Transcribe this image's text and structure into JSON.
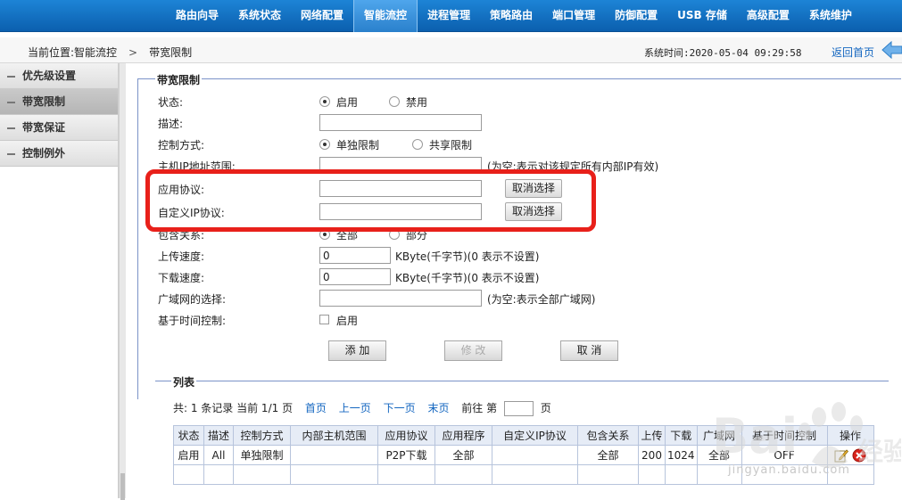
{
  "nav": {
    "items": [
      "路由向导",
      "系统状态",
      "网络配置",
      "智能流控",
      "进程管理",
      "策略路由",
      "端口管理",
      "防御配置",
      "USB 存储",
      "高级配置",
      "系统维护"
    ],
    "active": "智能流控"
  },
  "breadcrumb": {
    "location_label": "当前位置:智能流控",
    "separator": ">",
    "current": "带宽限制",
    "system_time": "系统时间:2020-05-04 09:29:58",
    "back_label": "返回首页"
  },
  "sidebar": {
    "items": [
      {
        "label": "优先级设置"
      },
      {
        "label": "带宽限制"
      },
      {
        "label": "带宽保证"
      },
      {
        "label": "控制例外"
      }
    ],
    "active": "带宽限制"
  },
  "form": {
    "legend": "带宽限制",
    "status": {
      "label": "状态:",
      "options": [
        "启用",
        "禁用"
      ],
      "selected": "启用"
    },
    "description": {
      "label": "描述:",
      "value": ""
    },
    "control_mode": {
      "label": "控制方式:",
      "options": [
        "单独限制",
        "共享限制"
      ],
      "selected": "单独限制"
    },
    "host_ip_range": {
      "label": "主机IP地址范围:",
      "value": "",
      "hint": "(为空:表示对该规定所有内部IP有效)"
    },
    "app_protocol": {
      "label": "应用协议:",
      "value": "",
      "button": "取消选择"
    },
    "custom_ip_protocol": {
      "label": "自定义IP协议:",
      "value": "",
      "button": "取消选择"
    },
    "include_relation": {
      "label": "包含关系:",
      "options": [
        "全部",
        "部分"
      ],
      "selected": "全部"
    },
    "upload_speed": {
      "label": "上传速度:",
      "value": "0",
      "hint": "KByte(千字节)(0 表示不设置)"
    },
    "download_speed": {
      "label": "下载速度:",
      "value": "0",
      "hint": "KByte(千字节)(0 表示不设置)"
    },
    "wan_select": {
      "label": "广域网的选择:",
      "value": "",
      "hint": "(为空:表示全部广域网)"
    },
    "time_control": {
      "label": "基于时间控制:",
      "option": "启用",
      "checked": false
    },
    "buttons": {
      "add": "添 加",
      "modify": "修 改",
      "cancel": "取 消"
    }
  },
  "list": {
    "legend": "列表",
    "summary": "共: 1 条记录 当前 1/1 页",
    "links": {
      "first": "首页",
      "prev": "上一页",
      "next": "下一页",
      "last": "末页"
    },
    "goto_prefix": "前往 第",
    "goto_suffix": "页",
    "columns": [
      "状态",
      "描述",
      "控制方式",
      "内部主机范围",
      "应用协议",
      "应用程序",
      "自定义IP协议",
      "包含关系",
      "上传",
      "下载",
      "广域网",
      "基于时间控制",
      "操作"
    ],
    "rows": [
      [
        "启用",
        "All",
        "单独限制",
        "",
        "P2P下载",
        "全部",
        "",
        "全部",
        "200",
        "1024",
        "全部",
        "OFF",
        ""
      ]
    ]
  },
  "watermark": {
    "text": "jingyan.baidu.com"
  },
  "colors": {
    "nav_bg": "#0b5fae",
    "highlight": "#e8201a",
    "link": "#1366c0"
  }
}
